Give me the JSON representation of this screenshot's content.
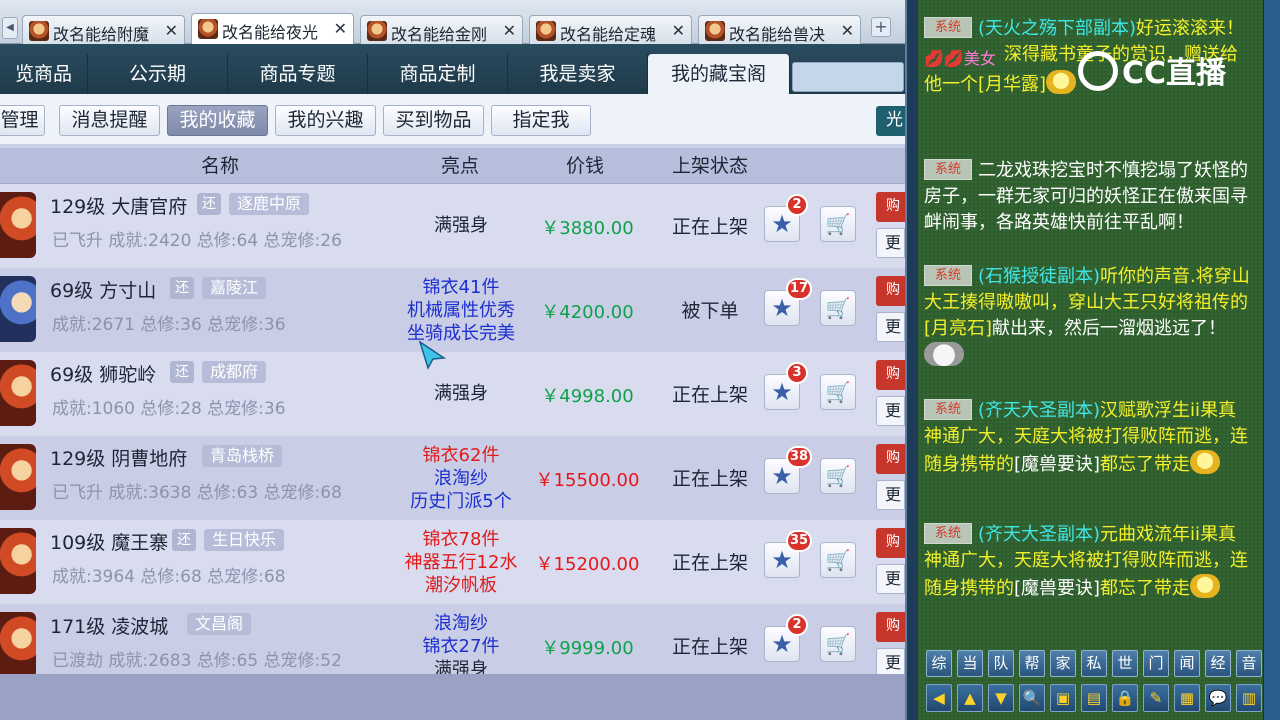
{
  "browser_tabs": [
    {
      "label": "改名能给附魔",
      "active": false
    },
    {
      "label": "改名能给夜光",
      "active": true
    },
    {
      "label": "改名能给金刚",
      "active": false
    },
    {
      "label": "改名能给定魂",
      "active": false
    },
    {
      "label": "改名能给兽决",
      "active": false
    }
  ],
  "tab_scroll_glyph": "◀",
  "close_glyph": "✕",
  "add_tab_glyph": "+",
  "nav": {
    "tabs": [
      "览商品",
      "公示期",
      "商品专题",
      "商品定制",
      "我是卖家",
      "我的藏宝阁"
    ],
    "active_index": 5
  },
  "subnav": {
    "buttons": [
      "管理",
      "消息提醒",
      "我的收藏",
      "我的兴趣",
      "买到物品",
      "指定我"
    ],
    "active_index": 2,
    "right_fragment": "光"
  },
  "table": {
    "headers": {
      "name": "名称",
      "highlight": "亮点",
      "price": "价钱",
      "status": "上架状态"
    },
    "rows": [
      {
        "level": "129级",
        "school": "大唐官府",
        "huan": "还",
        "server": "逐鹿中原",
        "stats": "已飞升 成就:2420 总修:64 总宠修:26",
        "highlights": [
          "满强身"
        ],
        "highlight_color": "black",
        "price": "￥3880.00",
        "price_color": "green",
        "status": "正在上架",
        "fav_count": "2",
        "buy": "购",
        "more": "更"
      },
      {
        "level": "69级",
        "school": "方寸山",
        "huan": "还",
        "server": "嘉陵江",
        "stats": "成就:2671 总修:36 总宠修:36",
        "highlights": [
          "锦衣41件",
          "机械属性优秀",
          "坐骑成长完美"
        ],
        "highlight_color": "blue",
        "price": "￥4200.00",
        "price_color": "green",
        "status": "被下单",
        "fav_count": "17",
        "buy": "购",
        "more": "更"
      },
      {
        "level": "69级",
        "school": "狮驼岭",
        "huan": "还",
        "server": "成都府",
        "stats": "成就:1060 总修:28 总宠修:36",
        "highlights": [
          "满强身"
        ],
        "highlight_color": "black",
        "price": "￥4998.00",
        "price_color": "green",
        "status": "正在上架",
        "fav_count": "3",
        "buy": "购",
        "more": "更"
      },
      {
        "level": "129级",
        "school": "阴曹地府",
        "huan": "",
        "server": "青岛栈桥",
        "stats": "已飞升 成就:3638 总修:63 总宠修:68",
        "highlights": [
          "锦衣62件",
          "浪淘纱",
          "历史门派5个"
        ],
        "highlight_color": "mixed",
        "price": "￥15500.00",
        "price_color": "red",
        "status": "正在上架",
        "fav_count": "38",
        "buy": "购",
        "more": "更"
      },
      {
        "level": "109级",
        "school": "魔王寨",
        "huan": "还",
        "server": "生日快乐",
        "stats": "成就:3964 总修:68 总宠修:68",
        "highlights": [
          "锦衣78件",
          "神器五行12水",
          "潮汐帆板"
        ],
        "highlight_color": "red",
        "price": "￥15200.00",
        "price_color": "red",
        "status": "正在上架",
        "fav_count": "35",
        "buy": "购",
        "more": "更"
      },
      {
        "level": "171级",
        "school": "凌波城",
        "huan": "",
        "server": "文昌阁",
        "stats": "已渡劫 成就:2683 总修:65 总宠修:52",
        "highlights": [
          "浪淘纱",
          "锦衣27件",
          "满强身"
        ],
        "highlight_color": "mixed2",
        "price": "￥9999.00",
        "price_color": "green",
        "status": "正在上架",
        "fav_count": "2",
        "buy": "购",
        "more": "更"
      }
    ]
  },
  "star_glyph": "★",
  "cart_glyph": "🛒",
  "chat": {
    "sys_label": "系统",
    "messages": [
      {
        "parts": [
          {
            "t": "(天火之殇下部副本)",
            "c": "cyan"
          },
          {
            "t": "好运滚滚来！",
            "c": "yellow"
          },
          {
            "t": "💋💋美女",
            "c": "lips"
          },
          {
            "t": "深得藏书童子的赏识，赠送给他一个",
            "c": "yellow"
          },
          {
            "t": "[月华露]",
            "c": "yellow"
          }
        ]
      },
      {
        "parts": [
          {
            "t": "二龙戏珠挖宝时不慎挖塌了妖怪的房子，一群无家可归的妖怪正在傲来国寻衅闹事，各路英雄快前往平乱啊！",
            "c": "white"
          }
        ]
      },
      {
        "parts": [
          {
            "t": "(石猴授徒副本)",
            "c": "cyan"
          },
          {
            "t": "听你的声音.将穿山大王揍得嗷嗷叫，穿山大王只好将祖传的",
            "c": "yellow"
          },
          {
            "t": "[月亮石]",
            "c": "yellow"
          },
          {
            "t": "献出来，然后一溜烟逃远了！",
            "c": "white"
          }
        ]
      },
      {
        "parts": [
          {
            "t": "(齐天大圣副本)",
            "c": "cyan"
          },
          {
            "t": "汉赋歌浮生ii",
            "c": "yellow"
          },
          {
            "t": "果真神通广大，天庭大将被打得败阵而逃，连随身携带的",
            "c": "yellow"
          },
          {
            "t": "[魔兽要诀]",
            "c": "white"
          },
          {
            "t": "都忘了带走",
            "c": "yellow"
          }
        ]
      },
      {
        "parts": [
          {
            "t": "(齐天大圣副本)",
            "c": "cyan"
          },
          {
            "t": "元曲戏流年ii",
            "c": "yellow"
          },
          {
            "t": "果真神通广大，天庭大将被打得败阵而逃，连随身携带的",
            "c": "yellow"
          },
          {
            "t": "[魔兽要诀]",
            "c": "white"
          },
          {
            "t": "都忘了带走",
            "c": "yellow"
          }
        ]
      }
    ]
  },
  "watermark": "CC直播",
  "chat_tabs": [
    "综",
    "当",
    "队",
    "帮",
    "家",
    "私",
    "世",
    "门",
    "闻",
    "经",
    "音"
  ],
  "chat_tools": [
    "◀",
    "▲",
    "▼",
    "🔍",
    "▣",
    "▤",
    "🔒",
    "✎",
    "▦",
    "💬",
    "▥"
  ]
}
